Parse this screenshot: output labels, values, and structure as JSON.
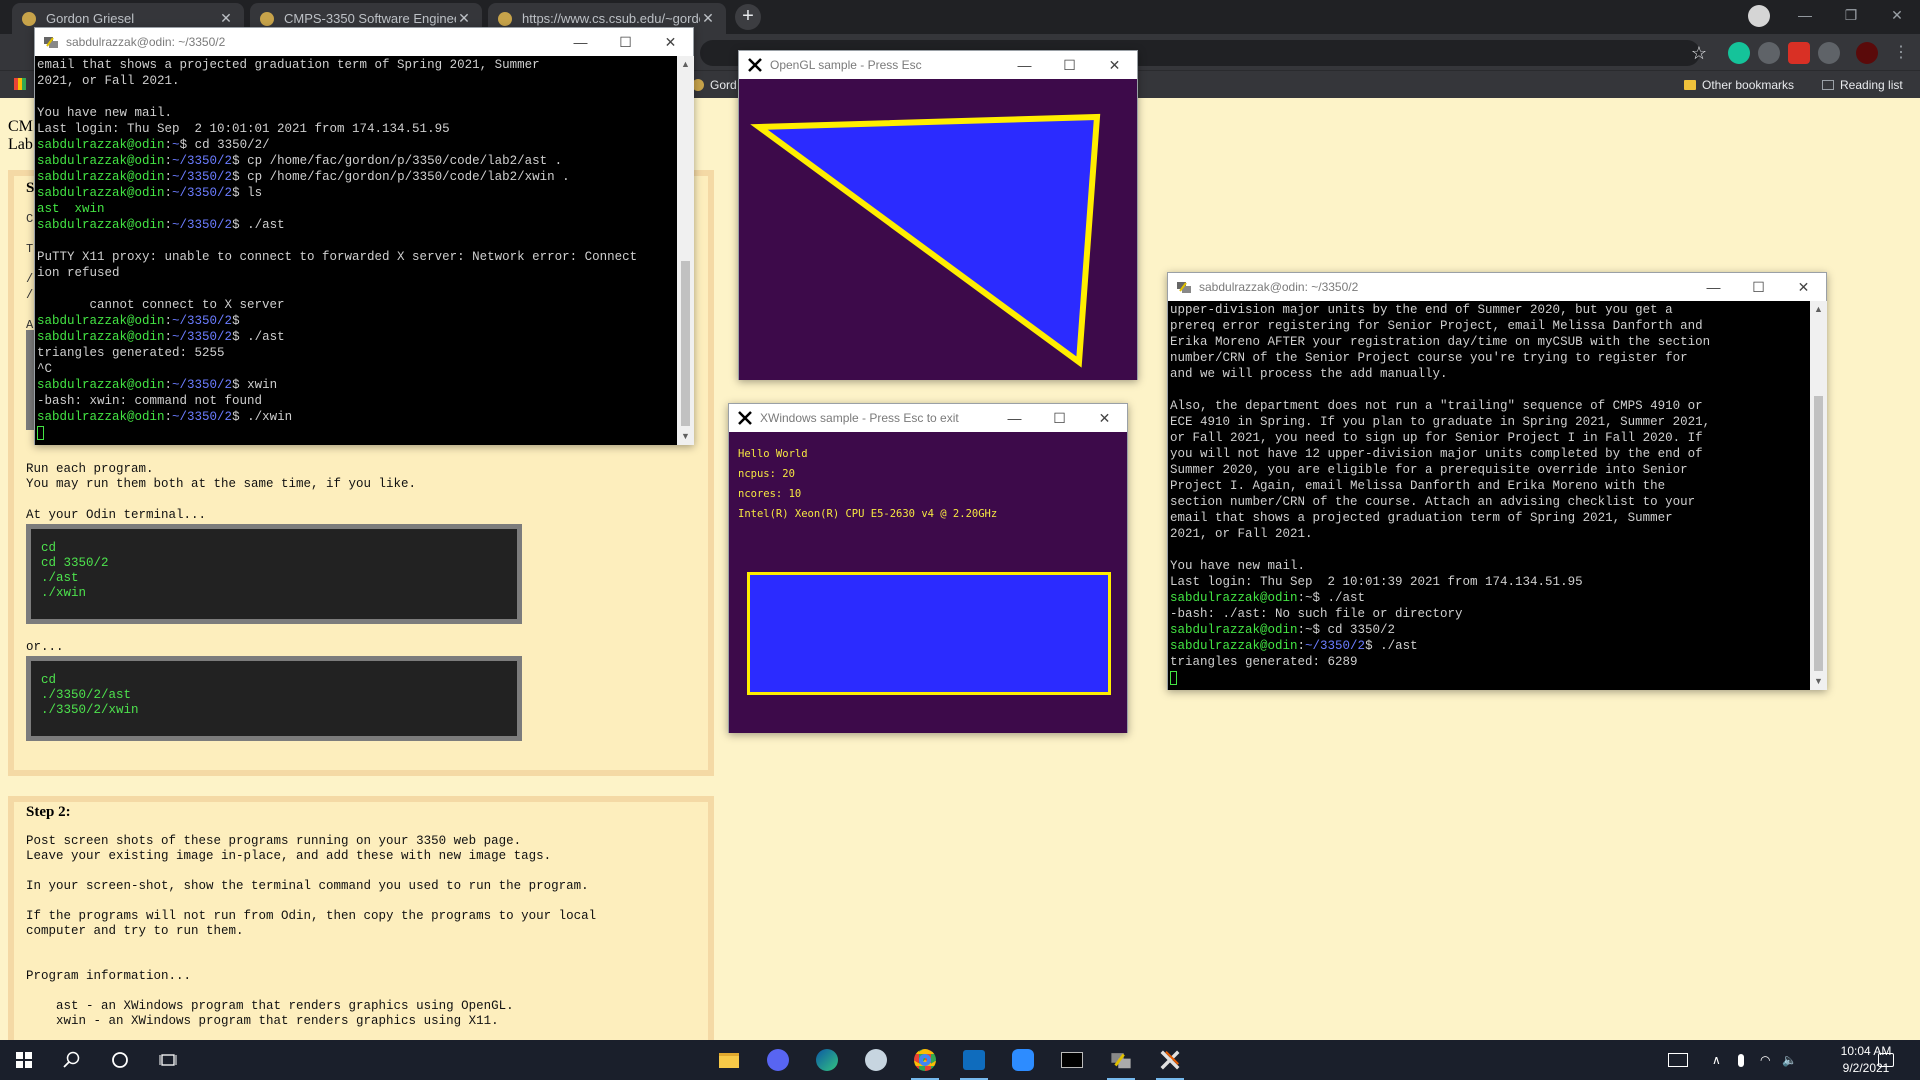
{
  "browser": {
    "tabs": [
      {
        "title": "Gordon Griesel"
      },
      {
        "title": "CMPS-3350 Software Engineerin"
      },
      {
        "title": "https://www.cs.csub.edu/~gordo"
      }
    ],
    "bookmarks": {
      "left_label": "Gord",
      "other": "Other bookmarks",
      "reading": "Reading list"
    }
  },
  "page": {
    "head_line1": "CM",
    "head_line2": "Lab",
    "step1_fragment": "S",
    "side_letters": [
      "C",
      "T",
      "/",
      "/",
      "A"
    ],
    "run_text": "Run each program.\nYou may run them both at the same time, if you like.",
    "odin_label": "At your Odin terminal...",
    "code1": "cd\ncd 3350/2\n./ast\n./xwin",
    "or_label": "or...",
    "code2": "cd\n./3350/2/ast\n./3350/2/xwin",
    "step2_title": "Step 2:",
    "step2_text": "Post screen shots of these programs running on your 3350 web page.\nLeave your existing image in-place, and add these with new image tags.\n\nIn your screen-shot, show the terminal command you used to run the program.\n\nIf the programs will not run from Odin, then copy the programs to your local\ncomputer and try to run them.\n\n\nProgram information...\n\n    ast - an XWindows program that renders graphics using OpenGL.\n    xwin - an XWindows program that renders graphics using X11."
  },
  "putty1": {
    "title": "sabdulrazzak@odin: ~/3350/2",
    "lines": [
      [
        {
          "t": "email that shows a projected graduation term of Spring 2021, Summer",
          "c": ""
        }
      ],
      [
        {
          "t": "2021, or Fall 2021.",
          "c": ""
        }
      ],
      [
        {
          "t": "",
          "c": ""
        }
      ],
      [
        {
          "t": "You have new mail.",
          "c": ""
        }
      ],
      [
        {
          "t": "Last login: Thu Sep  2 10:01:01 2021 from 174.134.51.95",
          "c": ""
        }
      ],
      [
        {
          "t": "sabdulrazzak@odin",
          "c": "g"
        },
        {
          "t": ":",
          "c": ""
        },
        {
          "t": "~",
          "c": "b"
        },
        {
          "t": "$ cd 3350/2/",
          "c": ""
        }
      ],
      [
        {
          "t": "sabdulrazzak@odin",
          "c": "g"
        },
        {
          "t": ":",
          "c": ""
        },
        {
          "t": "~/3350/2",
          "c": "b"
        },
        {
          "t": "$ cp /home/fac/gordon/p/3350/code/lab2/ast .",
          "c": ""
        }
      ],
      [
        {
          "t": "sabdulrazzak@odin",
          "c": "g"
        },
        {
          "t": ":",
          "c": ""
        },
        {
          "t": "~/3350/2",
          "c": "b"
        },
        {
          "t": "$ cp /home/fac/gordon/p/3350/code/lab2/xwin .",
          "c": ""
        }
      ],
      [
        {
          "t": "sabdulrazzak@odin",
          "c": "g"
        },
        {
          "t": ":",
          "c": ""
        },
        {
          "t": "~/3350/2",
          "c": "b"
        },
        {
          "t": "$ ls",
          "c": ""
        }
      ],
      [
        {
          "t": "ast  xwin",
          "c": "g"
        }
      ],
      [
        {
          "t": "sabdulrazzak@odin",
          "c": "g"
        },
        {
          "t": ":",
          "c": ""
        },
        {
          "t": "~/3350/2",
          "c": "b"
        },
        {
          "t": "$ ./ast",
          "c": ""
        }
      ],
      [
        {
          "t": "",
          "c": ""
        }
      ],
      [
        {
          "t": "PuTTY X11 proxy: unable to connect to forwarded X server: Network error: Connect",
          "c": ""
        }
      ],
      [
        {
          "t": "ion refused",
          "c": ""
        }
      ],
      [
        {
          "t": "",
          "c": ""
        }
      ],
      [
        {
          "t": "       cannot connect to X server",
          "c": ""
        }
      ],
      [
        {
          "t": "sabdulrazzak@odin",
          "c": "g"
        },
        {
          "t": ":",
          "c": ""
        },
        {
          "t": "~/3350/2",
          "c": "b"
        },
        {
          "t": "$",
          "c": ""
        }
      ],
      [
        {
          "t": "sabdulrazzak@odin",
          "c": "g"
        },
        {
          "t": ":",
          "c": ""
        },
        {
          "t": "~/3350/2",
          "c": "b"
        },
        {
          "t": "$ ./ast",
          "c": ""
        }
      ],
      [
        {
          "t": "triangles generated: 5255",
          "c": ""
        }
      ],
      [
        {
          "t": "^C",
          "c": ""
        }
      ],
      [
        {
          "t": "sabdulrazzak@odin",
          "c": "g"
        },
        {
          "t": ":",
          "c": ""
        },
        {
          "t": "~/3350/2",
          "c": "b"
        },
        {
          "t": "$ xwin",
          "c": ""
        }
      ],
      [
        {
          "t": "-bash: xwin: command not found",
          "c": ""
        }
      ],
      [
        {
          "t": "sabdulrazzak@odin",
          "c": "g"
        },
        {
          "t": ":",
          "c": ""
        },
        {
          "t": "~/3350/2",
          "c": "b"
        },
        {
          "t": "$ ./xwin",
          "c": ""
        }
      ]
    ]
  },
  "putty2": {
    "title": "sabdulrazzak@odin: ~/3350/2",
    "lines": [
      [
        {
          "t": "upper-division major units by the end of Summer 2020, but you get a",
          "c": ""
        }
      ],
      [
        {
          "t": "prereq error registering for Senior Project, email Melissa Danforth and",
          "c": ""
        }
      ],
      [
        {
          "t": "Erika Moreno AFTER your registration day/time on myCSUB with the section",
          "c": ""
        }
      ],
      [
        {
          "t": "number/CRN of the Senior Project course you're trying to register for",
          "c": ""
        }
      ],
      [
        {
          "t": "and we will process the add manually.",
          "c": ""
        }
      ],
      [
        {
          "t": "",
          "c": ""
        }
      ],
      [
        {
          "t": "Also, the department does not run a \"trailing\" sequence of CMPS 4910 or",
          "c": ""
        }
      ],
      [
        {
          "t": "ECE 4910 in Spring. If you plan to graduate in Spring 2021, Summer 2021,",
          "c": ""
        }
      ],
      [
        {
          "t": "or Fall 2021, you need to sign up for Senior Project I in Fall 2020. If",
          "c": ""
        }
      ],
      [
        {
          "t": "you will not have 12 upper-division major units completed by the end of",
          "c": ""
        }
      ],
      [
        {
          "t": "Summer 2020, you are eligible for a prerequisite override into Senior",
          "c": ""
        }
      ],
      [
        {
          "t": "Project I. Again, email Melissa Danforth and Erika Moreno with the",
          "c": ""
        }
      ],
      [
        {
          "t": "section number/CRN of the course. Attach an advising checklist to your",
          "c": ""
        }
      ],
      [
        {
          "t": "email that shows a projected graduation term of Spring 2021, Summer",
          "c": ""
        }
      ],
      [
        {
          "t": "2021, or Fall 2021.",
          "c": ""
        }
      ],
      [
        {
          "t": "",
          "c": ""
        }
      ],
      [
        {
          "t": "You have new mail.",
          "c": ""
        }
      ],
      [
        {
          "t": "Last login: Thu Sep  2 10:01:39 2021 from 174.134.51.95",
          "c": ""
        }
      ],
      [
        {
          "t": "sabdulrazzak@odin",
          "c": "g"
        },
        {
          "t": ":~$ ./ast",
          "c": ""
        }
      ],
      [
        {
          "t": "-bash: ./ast: No such file or directory",
          "c": ""
        }
      ],
      [
        {
          "t": "sabdulrazzak@odin",
          "c": "g"
        },
        {
          "t": ":~$ cd 3350/2",
          "c": ""
        }
      ],
      [
        {
          "t": "sabdulrazzak@odin",
          "c": "g"
        },
        {
          "t": ":",
          "c": ""
        },
        {
          "t": "~/3350/2",
          "c": "b"
        },
        {
          "t": "$ ./ast",
          "c": ""
        }
      ],
      [
        {
          "t": "triangles generated: 6289",
          "c": ""
        }
      ]
    ]
  },
  "opengl": {
    "title": "OpenGL sample  - Press Esc",
    "background": "#3d0a4a",
    "fill": "#2b2bff",
    "stroke": "#ffee00"
  },
  "xwin": {
    "title": "XWindows sample  - Press Esc to exit",
    "lines": [
      "Hello World",
      "ncpus: 20",
      "ncores: 10",
      "Intel(R) Xeon(R) CPU E5-2630 v4 @ 2.20GHz"
    ],
    "background": "#3d0a4a",
    "rect_fill": "#2b2bff",
    "rect_stroke": "#ffee00"
  },
  "taskbar": {
    "time": "10:04 AM",
    "date": "9/2/2021"
  },
  "icons": [
    "windows-start-icon",
    "search-icon",
    "cortana-icon",
    "task-view-icon",
    "file-explorer-icon",
    "discord-icon",
    "edge-icon",
    "steam-icon",
    "chrome-icon",
    "outlook-icon",
    "zoom-icon",
    "terminal-icon",
    "putty-icon",
    "xming-icon"
  ]
}
